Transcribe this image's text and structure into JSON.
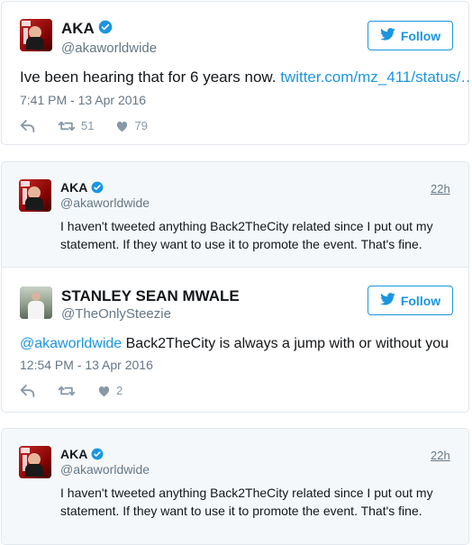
{
  "tweet1": {
    "name": "AKA",
    "handle": "@akaworldwide",
    "follow_label": "Follow",
    "text": "Ive been hearing that for 6 years now. ",
    "link": "twitter.com/mz_411/status/…",
    "timestamp": "7:41 PM - 13 Apr 2016",
    "retweets": "51",
    "likes": "79"
  },
  "reply1": {
    "name": "AKA",
    "handle": "@akaworldwide",
    "ago": "22h",
    "text": "I haven't tweeted anything Back2TheCity related since I put out my statement. If they want to use it to promote the event. That's fine."
  },
  "tweet2": {
    "name": "STANLEY SEAN MWALE",
    "handle": "@TheOnlySteezie",
    "follow_label": "Follow",
    "mention": "@akaworldwide",
    "text": " Back2TheCity is always a jump with or without you",
    "timestamp": "12:54 PM - 13 Apr 2016",
    "likes": "2"
  },
  "reply2": {
    "name": "AKA",
    "handle": "@akaworldwide",
    "ago": "22h",
    "text": "I haven't tweeted anything Back2TheCity related since I put out my statement. If they want to use it to promote the event. That's fine."
  },
  "colors": {
    "accent": "#1b95e0",
    "muted": "#657786",
    "border": "#e1e8ed",
    "quoted_bg": "#f5f8fa"
  }
}
